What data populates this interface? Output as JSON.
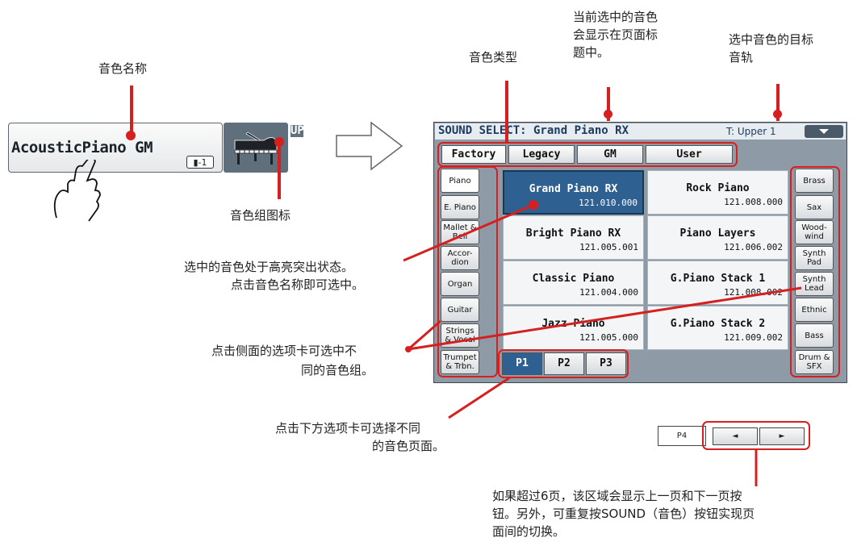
{
  "sound_button": {
    "name": "AcousticPiano GM",
    "octave": "-1",
    "track_label": "UP1",
    "icon": "grand-piano-icon"
  },
  "panel": {
    "title": "SOUND SELECT: Grand Piano RX",
    "track": "T: Upper 1",
    "top_tabs": [
      "Factory",
      "Legacy",
      "GM",
      "User"
    ],
    "left_tabs": [
      "Piano",
      "E. Piano",
      "Mallet & Bell",
      "Accor- dion",
      "Organ",
      "Guitar",
      "Strings & Vocal",
      "Trumpet & Trbn."
    ],
    "right_tabs": [
      "Brass",
      "Sax",
      "Wood- wind",
      "Synth Pad",
      "Synth Lead",
      "Ethnic",
      "Bass",
      "Drum & SFX"
    ],
    "sounds": [
      {
        "name": "Grand Piano RX",
        "number": "121.010.000"
      },
      {
        "name": "Rock Piano",
        "number": "121.008.000"
      },
      {
        "name": "Bright Piano RX",
        "number": "121.005.001"
      },
      {
        "name": "Piano Layers",
        "number": "121.006.002"
      },
      {
        "name": "Classic Piano",
        "number": "121.004.000"
      },
      {
        "name": "G.Piano Stack 1",
        "number": "121.008.002"
      },
      {
        "name": "Jazz Piano",
        "number": "121.005.000"
      },
      {
        "name": "G.Piano Stack 2",
        "number": "121.009.002"
      }
    ],
    "page_tabs": [
      "P1",
      "P2",
      "P3"
    ]
  },
  "extra_nav": {
    "page4": "P4",
    "prev": "◄",
    "next": "►"
  },
  "annotations": {
    "sound_name": "音色名称",
    "sound_group_icon": "音色组图标",
    "sound_type": "音色类型",
    "title_note_1": "当前选中的音色",
    "title_note_2": "会显示在页面标",
    "title_note_3": "题中。",
    "track_note_1": "选中音色的目标",
    "track_note_2": "音轨",
    "highlight_note_1": "选中的音色处于高亮突出状态。",
    "highlight_note_2": "点击音色名称即可选中。",
    "side_note_1": "点击侧面的选项卡可选中不",
    "side_note_2": "同的音色组。",
    "bottom_note_1": "点击下方选项卡可选择不同",
    "bottom_note_2": "的音色页面。",
    "nav_note_1": "如果超过6页，该区域会显示上一页和下一页按",
    "nav_note_2": "钮。另外，可重复按SOUND（音色）按钮实现页",
    "nav_note_3": "面间的切换。"
  },
  "colors": {
    "accent_red": "#d62020",
    "selected_blue": "#2f6092",
    "panel_gray": "#8e9ba6"
  }
}
